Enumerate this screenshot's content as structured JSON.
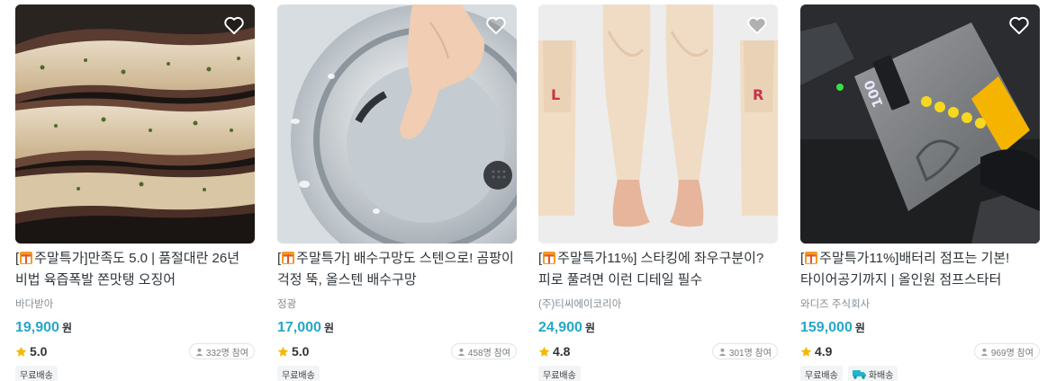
{
  "products": [
    {
      "title_prefix": "[",
      "title": "주말특가]만족도 5.0 | 품절대란 26년 비법 육즙폭발 쫀맛탱 오징어",
      "brand": "바다받아",
      "price": "19,900",
      "currency": "원",
      "rating": "5.0",
      "reviews": "332명 참여",
      "badges": [
        "무료배송"
      ],
      "image": "grilled-squid-photo"
    },
    {
      "title_prefix": "[",
      "title": "주말특가] 배수구망도 스텐으로! 곰팡이 걱정 뚝, 올스텐 배수구망",
      "brand": "정광",
      "price": "17,000",
      "currency": "원",
      "rating": "5.0",
      "reviews": "458명 참여",
      "badges": [
        "무료배송"
      ],
      "image": "stainless-drain-photo"
    },
    {
      "title_prefix": "[",
      "title": "주말특가11%] 스타킹에 좌우구분이? 피로 풀려면 이런 디테일 필수",
      "brand": "(주)티씨에이코리아",
      "price": "24,900",
      "currency": "원",
      "rating": "4.8",
      "reviews": "301명 참여",
      "badges": [
        "무료배송"
      ],
      "image": "calf-sleeves-photo",
      "image_labels": [
        "L",
        "R"
      ]
    },
    {
      "title_prefix": "[",
      "title": "주말특가11%]배터리 점프는 기본! 타이어공기까지 | 올인원 점프스타터",
      "brand": "와디즈 주식회사",
      "price": "159,000",
      "currency": "원",
      "rating": "4.9",
      "reviews": "969명 참여",
      "badges": [
        "무료배송",
        "화배송"
      ],
      "image": "jump-starter-photo",
      "image_labels": [
        "100"
      ]
    }
  ],
  "colors": {
    "price": "#26a7c9",
    "star": "#f5b800",
    "text": "#2f3438",
    "muted": "#828c94"
  },
  "icons": {
    "wishlist": "heart-outline-icon",
    "tag": "gift-icon",
    "rating": "star-icon",
    "reviewers": "person-icon",
    "delivery": "truck-icon"
  }
}
